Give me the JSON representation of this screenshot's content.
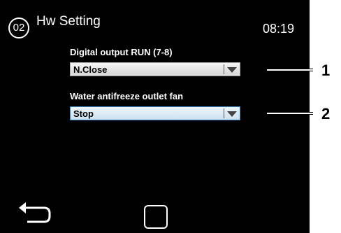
{
  "header": {
    "page_number": "02",
    "title": "Hw Setting",
    "time": "08:19"
  },
  "fields": [
    {
      "label": "Digital output RUN (7-8)",
      "value": "N.Close"
    },
    {
      "label": "Water antifreeze outlet fan",
      "value": "Stop"
    }
  ],
  "callouts": [
    "1",
    "2"
  ],
  "nav": {
    "back_icon": "back-arrow-icon",
    "home_icon": "home-square-icon"
  },
  "colors": {
    "screen_bg": "#000000",
    "text": "#ffffff",
    "selected_border": "#3d86c8"
  }
}
